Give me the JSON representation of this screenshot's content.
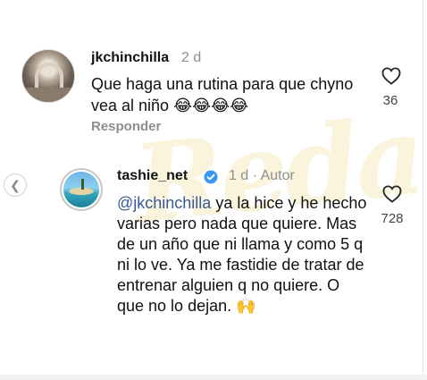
{
  "comments": [
    {
      "username": "jkchinchilla",
      "time": "2 d",
      "text": "Que haga una rutina para que chyno vea al niño 😂😂😂😂",
      "likes": "36",
      "reply_label": "Responder"
    },
    {
      "username": "tashie_net",
      "time": "1 d · Autor",
      "mention": "@jkchinchilla",
      "text": " ya la hice y he hecho varias pero nada que quiere. Mas de un año que ni llama y como 5 q ni lo ve. Ya me fastidie de tratar de entrenar alguien q no quiere. O que no lo dejan. 🙌",
      "likes": "728"
    }
  ],
  "watermark": "Reda",
  "colors": {
    "mention": "#385898",
    "muted": "#8e8e8e",
    "verified": "#3897f0"
  },
  "icons": {
    "like": "heart-icon",
    "verified": "verified-badge-icon",
    "nav": "chevron-left-icon"
  }
}
